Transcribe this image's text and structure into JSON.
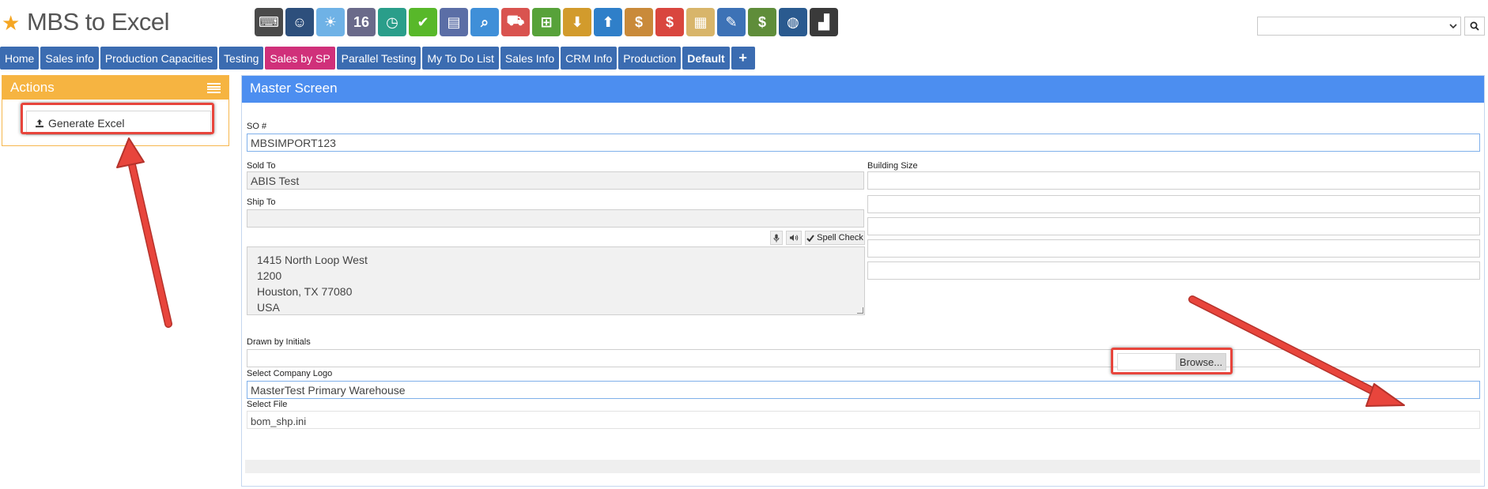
{
  "app": {
    "title": "MBS to Excel"
  },
  "toolbar_icons": [
    {
      "name": "keypad-icon",
      "color": "#4a4a4a",
      "glyph": "⌨"
    },
    {
      "name": "user-icon",
      "color": "#2d4f7c",
      "glyph": "☺"
    },
    {
      "name": "weather-icon",
      "color": "#6fb2e6",
      "glyph": "☀"
    },
    {
      "name": "calendar-icon",
      "color": "#6a6a8a",
      "glyph": "16"
    },
    {
      "name": "clock-icon",
      "color": "#2a9e8a",
      "glyph": "◷"
    },
    {
      "name": "check-icon",
      "color": "#58b82a",
      "glyph": "✔"
    },
    {
      "name": "gauge-icon",
      "color": "#5b6ea6",
      "glyph": "▤"
    },
    {
      "name": "search-icon",
      "color": "#3f8fd8",
      "glyph": "⌕"
    },
    {
      "name": "truck-icon",
      "color": "#d9534f",
      "glyph": "⛟"
    },
    {
      "name": "basket-icon",
      "color": "#57a23a",
      "glyph": "⊞"
    },
    {
      "name": "download-icon",
      "color": "#d29b2c",
      "glyph": "⬇"
    },
    {
      "name": "upload-icon",
      "color": "#2f7fc9",
      "glyph": "⬆"
    },
    {
      "name": "money-hand-icon",
      "color": "#c98a3a",
      "glyph": "$"
    },
    {
      "name": "price-bubble-icon",
      "color": "#d9463e",
      "glyph": "$"
    },
    {
      "name": "clipboard-icon",
      "color": "#d8b56a",
      "glyph": "▦"
    },
    {
      "name": "pencil-ruler-icon",
      "color": "#3d72b6",
      "glyph": "✎"
    },
    {
      "name": "cash-icon",
      "color": "#5f8d3a",
      "glyph": "$"
    },
    {
      "name": "globe-icon",
      "color": "#2a5a8f",
      "glyph": "◍"
    },
    {
      "name": "factory-icon",
      "color": "#3a3a3a",
      "glyph": "▟"
    }
  ],
  "search": {
    "value": ""
  },
  "tabs": [
    {
      "label": "Home",
      "active": false,
      "bold": false
    },
    {
      "label": "Sales info",
      "active": false,
      "bold": false
    },
    {
      "label": "Production Capacities",
      "active": false,
      "bold": false
    },
    {
      "label": "Testing",
      "active": false,
      "bold": false
    },
    {
      "label": "Sales by SP",
      "active": true,
      "bold": false
    },
    {
      "label": "Parallel Testing",
      "active": false,
      "bold": false
    },
    {
      "label": "My To Do List",
      "active": false,
      "bold": false
    },
    {
      "label": "Sales Info",
      "active": false,
      "bold": false
    },
    {
      "label": "CRM Info",
      "active": false,
      "bold": false
    },
    {
      "label": "Production",
      "active": false,
      "bold": false
    },
    {
      "label": "Default",
      "active": false,
      "bold": true
    }
  ],
  "tab_add_label": "+",
  "actions": {
    "title": "Actions",
    "generate_label": "Generate Excel"
  },
  "main": {
    "title": "Master Screen",
    "so_label": "SO #",
    "so_value": "MBSIMPORT123",
    "sold_to_label": "Sold To",
    "sold_to_value": "ABIS Test",
    "ship_to_label": "Ship To",
    "ship_to_value": "",
    "spell_check_label": "Spell Check",
    "address_lines": [
      "1415 North Loop West",
      "1200",
      "Houston, TX 77080",
      "USA"
    ],
    "building_size_label": "Building Size",
    "building_size_values": [
      "",
      "",
      "",
      "",
      ""
    ],
    "drawn_by_label": "Drawn by Initials",
    "drawn_by_value": "",
    "logo_label": "Select Company Logo",
    "logo_value": "MasterTest Primary Warehouse",
    "file_label": "Select File",
    "file_value": "bom_shp.ini",
    "browse_label": "Browse..."
  },
  "colors": {
    "tab_bg": "#3b6cb1",
    "tab_active": "#d0307a",
    "actions_head": "#f6b441",
    "main_head": "#4c8ef0",
    "annotation": "#e8453c"
  }
}
